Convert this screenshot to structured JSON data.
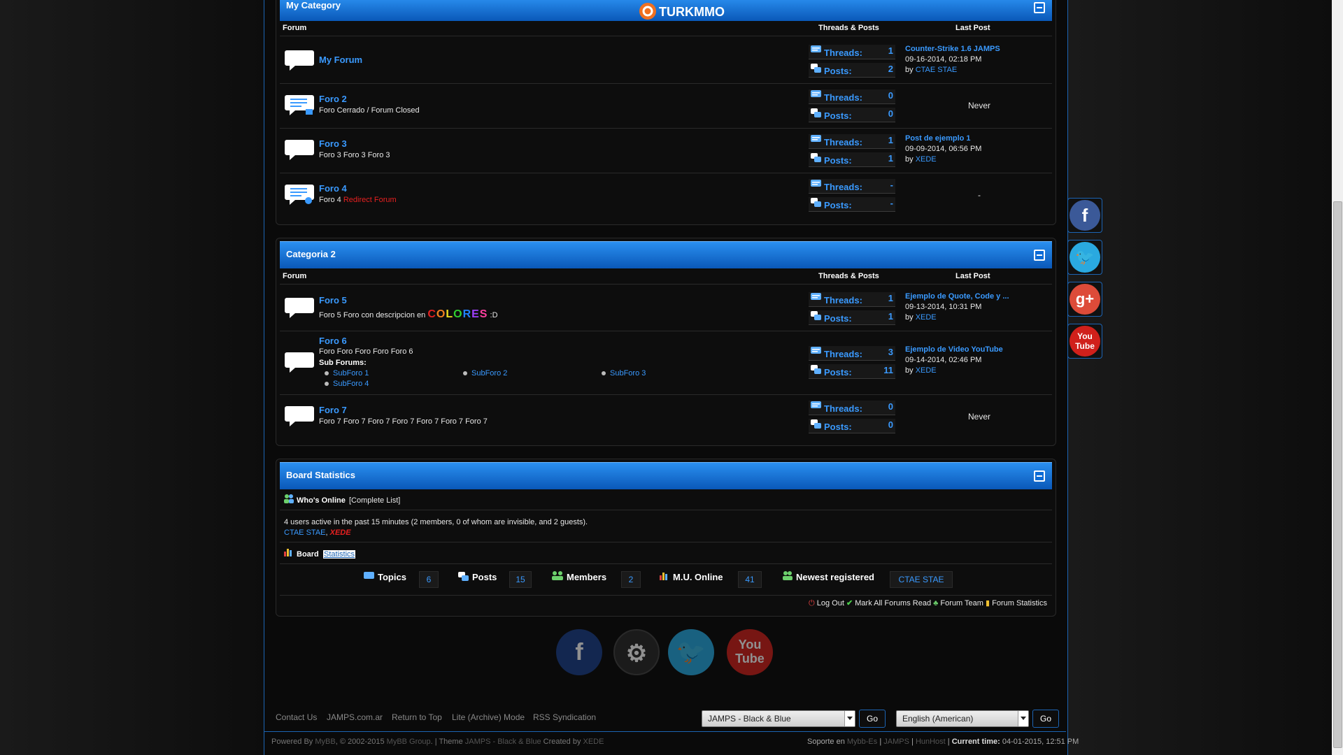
{
  "brand": {
    "logo_text": "TURKMMO"
  },
  "columns": {
    "forum": "Forum",
    "threads_posts": "Threads & Posts",
    "last_post": "Last Post"
  },
  "categories": [
    {
      "title": "My Category",
      "forums": [
        {
          "name": "My Forum",
          "desc": "",
          "threads_label": "Threads:",
          "threads": "1",
          "posts_label": "Posts:",
          "posts": "2",
          "lp_title": "Counter-Strike 1.6 JAMPS",
          "lp_date": "09-16-2014, 02:18 PM",
          "lp_by": "by ",
          "lp_user": "CTAE STAE"
        },
        {
          "name": "Foro 2",
          "desc": "Foro Cerrado / Forum Closed",
          "threads_label": "Threads:",
          "threads": "0",
          "posts_label": "Posts:",
          "posts": "0",
          "never": "Never"
        },
        {
          "name": "Foro 3",
          "desc": "Foro 3 Foro 3 Foro 3",
          "threads_label": "Threads:",
          "threads": "1",
          "posts_label": "Posts:",
          "posts": "1",
          "lp_title": "Post de ejemplo 1",
          "lp_date": "09-09-2014, 06:56 PM",
          "lp_by": "by ",
          "lp_user": "XEDE"
        },
        {
          "name": "Foro 4",
          "desc": "Foro 4 ",
          "desc_red": "Redirect Forum",
          "threads_label": "Threads:",
          "threads": "-",
          "posts_label": "Posts:",
          "posts": "-",
          "never": "-"
        }
      ]
    },
    {
      "title": "Categoria 2",
      "forums": [
        {
          "name": "Foro 5",
          "desc": "Foro 5 Foro con descripcion en ",
          "colores": "COLORES",
          "desc_tail": " :D",
          "threads_label": "Threads:",
          "threads": "1",
          "posts_label": "Posts:",
          "posts": "1",
          "lp_title": "Ejemplo de Quote, Code y ...",
          "lp_date": "09-13-2014, 10:31 PM",
          "lp_by": "by ",
          "lp_user": "XEDE"
        },
        {
          "name": "Foro 6",
          "desc": "Foro Foro Foro Foro Foro 6",
          "subforums_label": "Sub Forums:",
          "subforums": [
            "SubForo 1",
            "SubForo 2",
            "SubForo 3",
            "SubForo 4"
          ],
          "threads_label": "Threads:",
          "threads": "3",
          "posts_label": "Posts:",
          "posts": "11",
          "lp_title": "Ejemplo de Video YouTube",
          "lp_date": "09-14-2014, 02:46 PM",
          "lp_by": "by ",
          "lp_user": "XEDE"
        },
        {
          "name": "Foro 7",
          "desc": "Foro 7 Foro 7 Foro 7 Foro 7 Foro 7 Foro 7 Foro 7",
          "threads_label": "Threads:",
          "threads": "0",
          "posts_label": "Posts:",
          "posts": "0",
          "never": "Never"
        }
      ]
    }
  ],
  "stats": {
    "title": "Board Statistics",
    "whos_online": "Who's Online",
    "complete_list": "[Complete List]",
    "active_text": "4 users active in the past 15 minutes (2 members, 0 of whom are invisible, and 2 guests).",
    "online_user_1": "CTAE STAE",
    "online_sep": ", ",
    "online_user_2": "XEDE",
    "board_label": "Board",
    "statistics_label": "Statistics",
    "topics_label": "Topics",
    "topics": "6",
    "posts_label": "Posts",
    "posts": "15",
    "members_label": "Members",
    "members": "2",
    "mu_label": "M.U. Online",
    "mu": "41",
    "newest_label": "Newest registered",
    "newest": "CTAE STAE",
    "logout": "Log Out",
    "mark_read": "Mark All Forums Read",
    "forum_team": "Forum Team",
    "forum_stats": "Forum Statistics"
  },
  "footer": {
    "links": [
      "Contact Us",
      "JAMPS.com.ar",
      "Return to Top",
      "Lite (Archive) Mode",
      "RSS Syndication"
    ],
    "theme_select": "JAMPS - Black & Blue",
    "lang_select": "English (American)",
    "go": "Go",
    "powered_prefix": "Powered By ",
    "mybb": "MyBB",
    "copyright": ", © 2002-2015 ",
    "mybb_group": "MyBB Group",
    "theme_prefix": ". | Theme ",
    "theme_name": "JAMPS - Black & Blue",
    "created_by": " Created by ",
    "author": "XEDE",
    "soporte": "Soporte en ",
    "mybb_es": "Mybb-Es",
    "sep": " | ",
    "jamps": "JAMPS",
    "hunhost": "HunHost",
    "current_time_label": "Current time:",
    "current_time": " 04-01-2015, 12:51 PM"
  },
  "icons": [
    "facebook-icon",
    "twitter-icon",
    "google-plus-icon",
    "youtube-icon",
    "steam-icon"
  ]
}
